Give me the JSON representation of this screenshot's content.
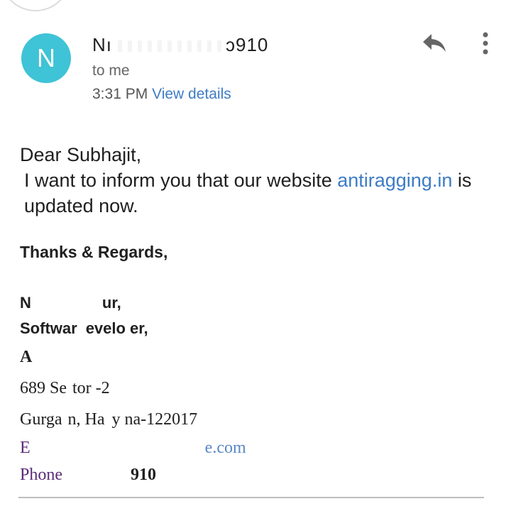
{
  "sender": {
    "avatar_initial": "N",
    "name_start": "Nı",
    "name_end": "ɔ910"
  },
  "recipient_label": "to me",
  "time": "3:31 PM",
  "view_details_label": "View details",
  "icons": {
    "reply": "reply-arrow-icon",
    "more": "more-vert-icon"
  },
  "message": {
    "greeting": "Dear Subhajit,",
    "text_before_link": "I want to inform you that our website ",
    "link_text": "antiragging.in",
    "text_after_link": " is updated now."
  },
  "signature": {
    "closing": "Thanks & Regards,",
    "name_start": "N",
    "name_end": "ur,",
    "title_start": "Softwar",
    "title_mid": "evelo",
    "title_end": "er,",
    "org_start": "A",
    "address1_start": "689 Se",
    "address1_end": "tor -2",
    "address2_start": "Gurga",
    "address2_mid1": "n, Ha",
    "address2_mid2": "y",
    "address2_end": "na-122017",
    "email_start": "E",
    "email_end": "e.com",
    "phone_start": "Phone",
    "phone_end": "910"
  },
  "colors": {
    "avatar": "#3fc3d6",
    "link": "#3d7cc4",
    "signature_purple": "#5a2b7a"
  }
}
